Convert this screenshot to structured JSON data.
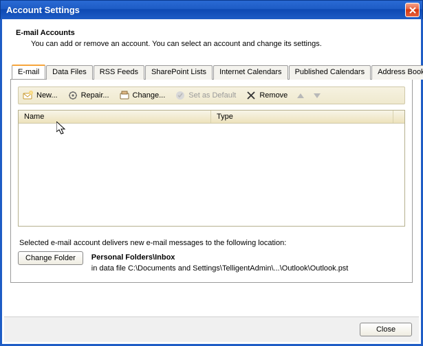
{
  "window": {
    "title": "Account Settings"
  },
  "header": {
    "title": "E-mail Accounts",
    "subtitle": "You can add or remove an account. You can select an account and change its settings."
  },
  "tabs": [
    {
      "label": "E-mail",
      "active": true
    },
    {
      "label": "Data Files",
      "active": false
    },
    {
      "label": "RSS Feeds",
      "active": false
    },
    {
      "label": "SharePoint Lists",
      "active": false
    },
    {
      "label": "Internet Calendars",
      "active": false
    },
    {
      "label": "Published Calendars",
      "active": false
    },
    {
      "label": "Address Books",
      "active": false
    }
  ],
  "toolbar": {
    "new_label": "New...",
    "repair_label": "Repair...",
    "change_label": "Change...",
    "default_label": "Set as Default",
    "remove_label": "Remove"
  },
  "columns": {
    "name": "Name",
    "type": "Type"
  },
  "delivery": {
    "desc": "Selected e-mail account delivers new e-mail messages to the following location:",
    "change_folder_label": "Change Folder",
    "folder": "Personal Folders\\Inbox",
    "path": "in data file C:\\Documents and Settings\\TelligentAdmin\\...\\Outlook\\Outlook.pst"
  },
  "footer": {
    "close_label": "Close"
  }
}
